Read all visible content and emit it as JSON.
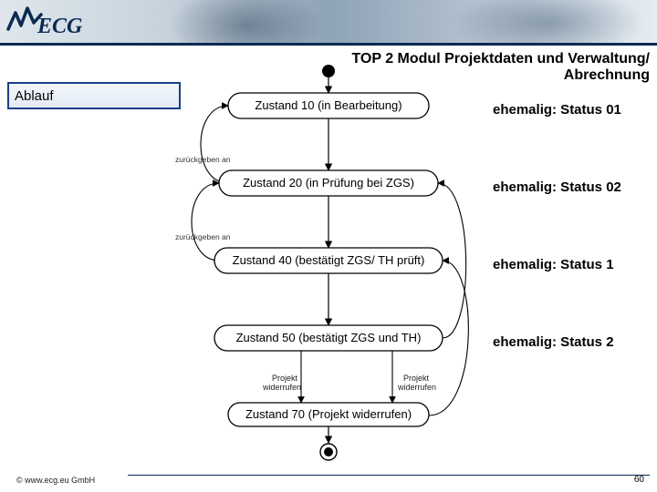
{
  "brand": {
    "name": "ECG"
  },
  "title_line1": "TOP 2 Modul Projektdaten und Verwaltung/",
  "title_line2": "Abrechnung",
  "section_label": "Ablauf",
  "states": {
    "z10": "Zustand 10 (in Bearbeitung)",
    "z20": "Zustand 20 (in Prüfung bei ZGS)",
    "z40": "Zustand 40 (bestätigt ZGS/ TH prüft)",
    "z50": "Zustand 50 (bestätigt ZGS und TH)",
    "z70": "Zustand 70 (Projekt widerrufen)"
  },
  "annotations": {
    "return_to": "zurückgeben an",
    "revoke": "Projekt\nwiderrufen"
  },
  "status_labels": {
    "s01": "ehemalig: Status 01",
    "s02": "ehemalig: Status 02",
    "s1": "ehemalig: Status 1",
    "s2": "ehemalig: Status 2"
  },
  "footer": {
    "copyright": "© www.ecg.eu GmbH",
    "page": "60"
  }
}
